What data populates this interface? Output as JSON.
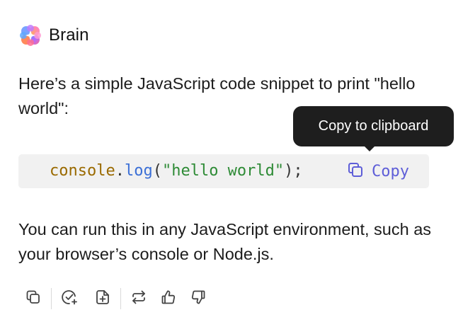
{
  "assistant": {
    "name": "Brain",
    "logo_icon": "brain-sparkle-logo-icon"
  },
  "message": {
    "intro": "Here’s a simple JavaScript code snippet to print \"hello world\":",
    "followup": "You can run this in any JavaScript environment, such as your browser’s console or Node.js."
  },
  "code_block": {
    "tokens": {
      "object": "console",
      "dot": ".",
      "method": "log",
      "open_paren": "(",
      "string": "\"hello world\"",
      "close": ");"
    },
    "copy_label": "Copy",
    "copy_icon": "copy-icon",
    "colors": {
      "background": "#f1f1f1",
      "object": "#9a6a00",
      "method": "#3b6fd6",
      "string": "#2e8b36",
      "copy": "#5e5ed8"
    }
  },
  "tooltip": {
    "text": "Copy to clipboard"
  },
  "actions": [
    {
      "name": "copy-message",
      "icon": "copy-icon"
    },
    {
      "name": "check-accuracy",
      "icon": "check-circle-plus-icon"
    },
    {
      "name": "add-to-document",
      "icon": "document-plus-icon"
    },
    {
      "name": "regenerate",
      "icon": "repeat-icon"
    },
    {
      "name": "thumbs-up",
      "icon": "thumbs-up-icon"
    },
    {
      "name": "thumbs-down",
      "icon": "thumbs-down-icon"
    }
  ]
}
